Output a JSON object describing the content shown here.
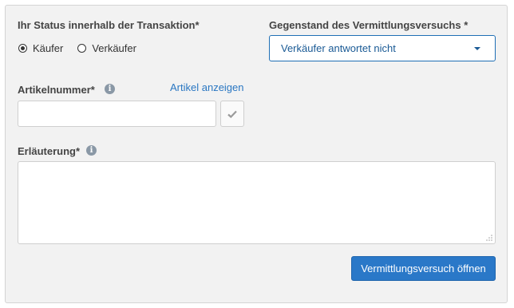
{
  "status_section": {
    "label": "Ihr Status innerhalb der Transaktion*",
    "options": [
      {
        "label": "Käufer",
        "checked": true
      },
      {
        "label": "Verkäufer",
        "checked": false
      }
    ]
  },
  "subject_section": {
    "label": "Gegenstand des Vermittlungsversuchs *",
    "selected_value": "Verkäufer antwortet nicht",
    "accent_color": "#1f6fb5"
  },
  "article_section": {
    "label": "Artikelnummer*",
    "info_icon": "info-icon",
    "view_link": "Artikel anzeigen",
    "input_value": "",
    "confirm_icon": "check-icon"
  },
  "explanation_section": {
    "label": "Erläuterung*",
    "info_icon": "info-icon",
    "textarea_value": ""
  },
  "submit": {
    "label": "Vermittlungsversuch öffnen",
    "color": "#2a78c8"
  }
}
